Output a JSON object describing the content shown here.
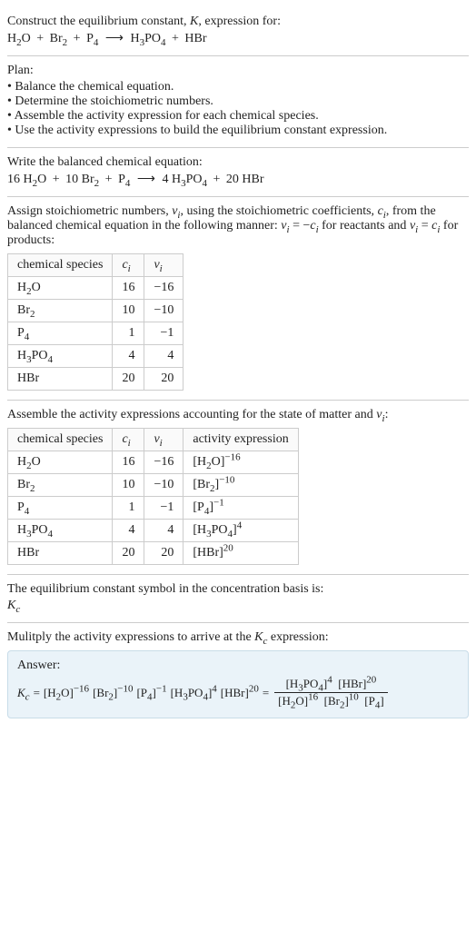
{
  "header": {
    "prompt_line1": "Construct the equilibrium constant, ",
    "K": "K",
    "prompt_line1_tail": ", expression for:"
  },
  "unbalanced": {
    "r1": {
      "f": "H",
      "s1": "2",
      "f2": "O"
    },
    "r2": {
      "f": "Br",
      "s1": "2"
    },
    "r3": {
      "f": "P",
      "s1": "4"
    },
    "p1": {
      "f": "H",
      "s1": "3",
      "f2": "PO",
      "s2": "4"
    },
    "p2": {
      "f": "HBr"
    }
  },
  "plan": {
    "title": "Plan:",
    "items": [
      "Balance the chemical equation.",
      "Determine the stoichiometric numbers.",
      "Assemble the activity expression for each chemical species.",
      "Use the activity expressions to build the equilibrium constant expression."
    ]
  },
  "balanced": {
    "intro": "Write the balanced chemical equation:",
    "c": {
      "r1": "16",
      "r2": "10",
      "r3": "",
      "p1": "4",
      "p2": "20"
    }
  },
  "stoich": {
    "intro1": "Assign stoichiometric numbers, ",
    "nu": "ν",
    "i": "i",
    "intro2": ", using the stoichiometric coefficients, ",
    "c": "c",
    "intro3": ", from the balanced chemical equation in the following manner: ",
    "rel1a": "ν",
    "rel1b": " = −",
    "rel1c": "c",
    "rel1tail": " for reactants and ",
    "rel2a": "ν",
    "rel2b": " = ",
    "rel2c": "c",
    "rel2tail": " for products:",
    "headers": {
      "sp": "chemical species",
      "ci": "c",
      "nui": "ν",
      "i": "i"
    },
    "rows": [
      {
        "sp": {
          "a": "H",
          "s1": "2",
          "b": "O"
        },
        "ci": "16",
        "nui": "−16"
      },
      {
        "sp": {
          "a": "Br",
          "s1": "2"
        },
        "ci": "10",
        "nui": "−10"
      },
      {
        "sp": {
          "a": "P",
          "s1": "4"
        },
        "ci": "1",
        "nui": "−1"
      },
      {
        "sp": {
          "a": "H",
          "s1": "3",
          "b": "PO",
          "s2": "4"
        },
        "ci": "4",
        "nui": "4"
      },
      {
        "sp": {
          "a": "HBr"
        },
        "ci": "20",
        "nui": "20"
      }
    ]
  },
  "activity": {
    "intro1": "Assemble the activity expressions accounting for the state of matter and ",
    "nu": "ν",
    "i": "i",
    "intro2": ":",
    "headers": {
      "sp": "chemical species",
      "ci": "c",
      "nui": "ν",
      "i": "i",
      "ae": "activity expression"
    },
    "rows": [
      {
        "sp": {
          "a": "H",
          "s1": "2",
          "b": "O"
        },
        "ci": "16",
        "nui": "−16",
        "ae": {
          "b": "[H",
          "s1": "2",
          "c": "O]",
          "exp": "−16"
        }
      },
      {
        "sp": {
          "a": "Br",
          "s1": "2"
        },
        "ci": "10",
        "nui": "−10",
        "ae": {
          "b": "[Br",
          "s1": "2",
          "c": "]",
          "exp": "−10"
        }
      },
      {
        "sp": {
          "a": "P",
          "s1": "4"
        },
        "ci": "1",
        "nui": "−1",
        "ae": {
          "b": "[P",
          "s1": "4",
          "c": "]",
          "exp": "−1"
        }
      },
      {
        "sp": {
          "a": "H",
          "s1": "3",
          "b": "PO",
          "s2": "4"
        },
        "ci": "4",
        "nui": "4",
        "ae": {
          "b": "[H",
          "s1": "3",
          "c": "PO",
          "s2": "4",
          "d": "]",
          "exp": "4"
        }
      },
      {
        "sp": {
          "a": "HBr"
        },
        "ci": "20",
        "nui": "20",
        "ae": {
          "b": "[HBr]",
          "exp": "20"
        }
      }
    ]
  },
  "kcnote": {
    "line1": "The equilibrium constant symbol in the concentration basis is:",
    "K": "K",
    "c": "c"
  },
  "final": {
    "intro": "Mulitply the activity expressions to arrive at the ",
    "K": "K",
    "c": "c",
    "intro2": " expression:",
    "answer_label": "Answer:",
    "eq_parts": {
      "eq": " = "
    },
    "terms": [
      {
        "b": "[H",
        "s1": "2",
        "c": "O]",
        "exp": "−16"
      },
      {
        "b": "[Br",
        "s1": "2",
        "c": "]",
        "exp": "−10"
      },
      {
        "b": "[P",
        "s1": "4",
        "c": "]",
        "exp": "−1"
      },
      {
        "b": "[H",
        "s1": "3",
        "c": "PO",
        "s2": "4",
        "d": "]",
        "exp": "4"
      },
      {
        "b": "[HBr]",
        "exp": "20"
      }
    ],
    "num": [
      {
        "b": "[H",
        "s1": "3",
        "c": "PO",
        "s2": "4",
        "d": "]",
        "exp": "4"
      },
      {
        "b": "[HBr]",
        "exp": "20"
      }
    ],
    "den": [
      {
        "b": "[H",
        "s1": "2",
        "c": "O]",
        "exp": "16"
      },
      {
        "b": "[Br",
        "s1": "2",
        "c": "]",
        "exp": "10"
      },
      {
        "b": "[P",
        "s1": "4",
        "c": "]"
      }
    ]
  }
}
